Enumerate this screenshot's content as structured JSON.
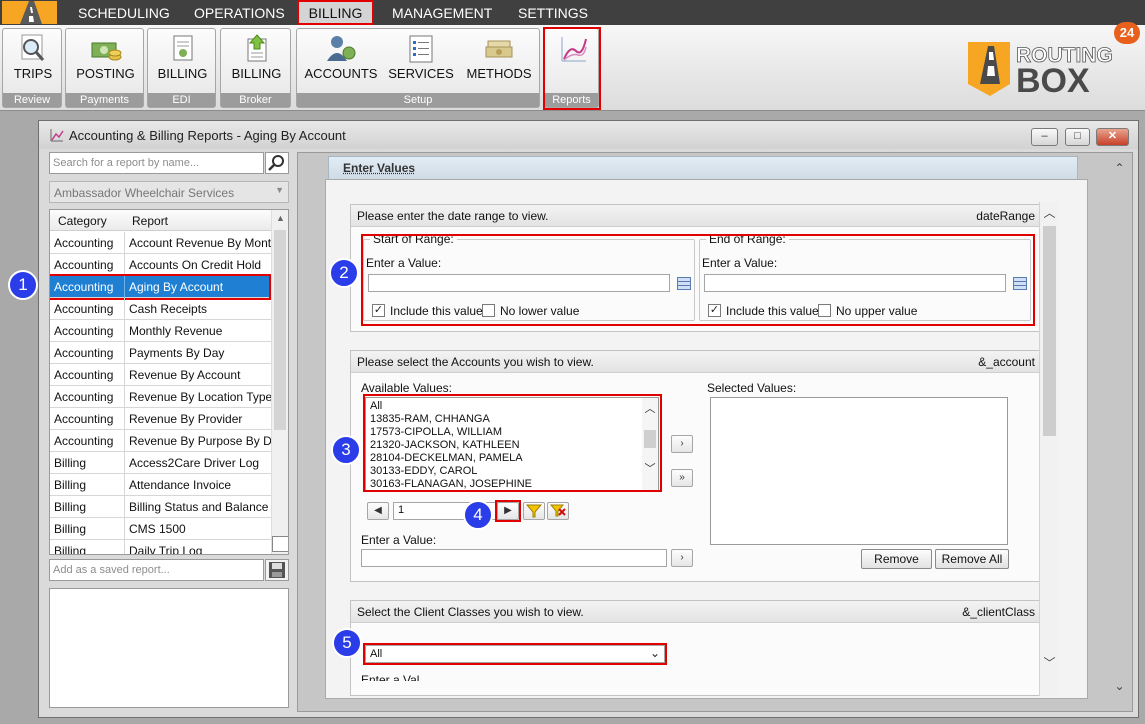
{
  "menu": {
    "items": [
      {
        "label": "SCHEDULING"
      },
      {
        "label": "OPERATIONS"
      },
      {
        "label": "BILLING"
      },
      {
        "label": "MANAGEMENT"
      },
      {
        "label": "SETTINGS"
      }
    ],
    "active": "BILLING"
  },
  "ribbon": {
    "groups": [
      {
        "label": "Review",
        "buttons": [
          {
            "label": "TRIPS"
          }
        ]
      },
      {
        "label": "Payments",
        "buttons": [
          {
            "label": "POSTING"
          }
        ]
      },
      {
        "label": "EDI",
        "buttons": [
          {
            "label": "BILLING"
          }
        ]
      },
      {
        "label": "Broker",
        "buttons": [
          {
            "label": "BILLING"
          }
        ]
      },
      {
        "label": "Setup",
        "buttons": [
          {
            "label": "ACCOUNTS"
          },
          {
            "label": "SERVICES"
          },
          {
            "label": "METHODS"
          }
        ]
      },
      {
        "label": "Reports",
        "buttons": [
          {
            "label": ""
          }
        ]
      }
    ]
  },
  "brand": {
    "line1": "ROUTING",
    "line2": "BOX",
    "notification_count": "24"
  },
  "window": {
    "title": "Accounting & Billing Reports - Aging By Account",
    "buttons": {
      "minimize": "–",
      "maximize": "□",
      "close": "✕"
    }
  },
  "left": {
    "search_placeholder": "Search for a report by name...",
    "company": "Ambassador Wheelchair Services",
    "columns": {
      "category": "Category",
      "report": "Report"
    },
    "reports": [
      {
        "category": "Accounting",
        "report": "Account Revenue By Month"
      },
      {
        "category": "Accounting",
        "report": "Accounts On Credit Hold"
      },
      {
        "category": "Accounting",
        "report": "Aging By Account"
      },
      {
        "category": "Accounting",
        "report": "Cash Receipts"
      },
      {
        "category": "Accounting",
        "report": "Monthly Revenue"
      },
      {
        "category": "Accounting",
        "report": "Payments By Day"
      },
      {
        "category": "Accounting",
        "report": "Revenue By Account"
      },
      {
        "category": "Accounting",
        "report": "Revenue By Location Type"
      },
      {
        "category": "Accounting",
        "report": "Revenue By Provider"
      },
      {
        "category": "Accounting",
        "report": "Revenue By Purpose By D..."
      },
      {
        "category": "Billing",
        "report": "Access2Care Driver Log"
      },
      {
        "category": "Billing",
        "report": "Attendance Invoice"
      },
      {
        "category": "Billing",
        "report": "Billing Status and Balance"
      },
      {
        "category": "Billing",
        "report": "CMS 1500"
      },
      {
        "category": "Billing",
        "report": "Daily Trip Log"
      }
    ],
    "selected_report": "Aging By Account",
    "saved_placeholder": "Add as a saved report..."
  },
  "enter_values": {
    "title": "Enter Values",
    "date_range": {
      "prompt": "Please enter the date range to view.",
      "key": "dateRange",
      "start": {
        "title": "Start of Range:",
        "label": "Enter a Value:",
        "value": "",
        "include": "Include this value",
        "include_checked": true,
        "no_bound": "No lower value",
        "no_bound_checked": false
      },
      "end": {
        "title": "End of Range:",
        "label": "Enter a Value:",
        "value": "",
        "include": "Include this value",
        "include_checked": true,
        "no_bound": "No upper value",
        "no_bound_checked": false
      }
    },
    "accounts": {
      "prompt": "Please select the Accounts you wish to view.",
      "key": "&_account",
      "available_label": "Available Values:",
      "selected_label": "Selected Values:",
      "available": [
        "All",
        "13835-RAM, CHHANGA",
        "17573-CIPOLLA, WILLIAM",
        "21320-JACKSON, KATHLEEN",
        "28104-DECKELMAN, PAMELA",
        "30133-EDDY, CAROL",
        "30163-FLANAGAN, JOSEPHINE"
      ],
      "selected": [],
      "page": "1",
      "enter_label": "Enter a Value:",
      "enter_value": "",
      "remove": "Remove",
      "remove_all": "Remove All",
      "add_one": "›",
      "add_all": "»"
    },
    "client_classes": {
      "prompt": "Select the Client Classes you wish to view.",
      "key": "&_clientClass",
      "selected": "All",
      "cut_label": "Enter a Val"
    }
  },
  "callouts": [
    "1",
    "2",
    "3",
    "4",
    "5"
  ],
  "colors": {
    "accent_red": "#e00000",
    "selection_blue": "#1f7fd3",
    "callout_blue": "#2b3de8",
    "brand_orange": "#e8601c"
  }
}
